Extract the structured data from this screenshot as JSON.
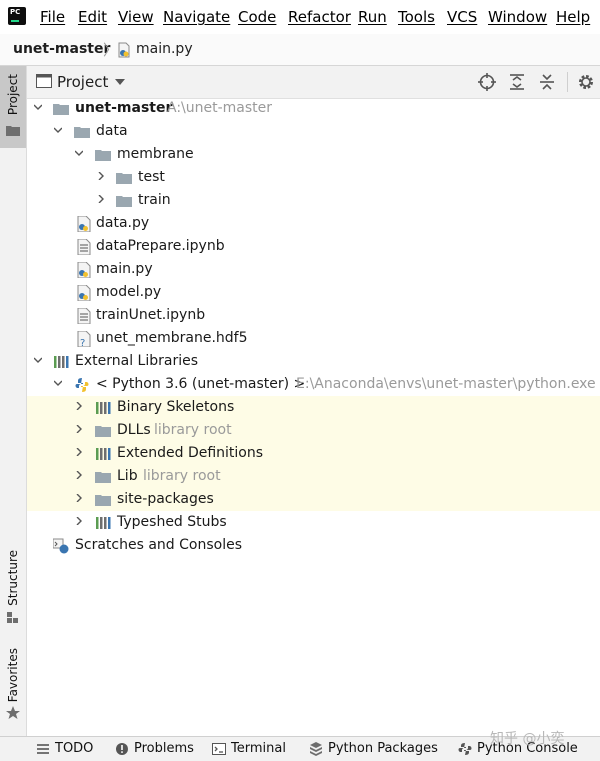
{
  "menu": [
    "File",
    "Edit",
    "View",
    "Navigate",
    "Code",
    "Refactor",
    "Run",
    "Tools",
    "VCS",
    "Window",
    "Help"
  ],
  "app_logo": "PC",
  "nav": {
    "project": "unet-master",
    "separator": "〉",
    "file": "main.py"
  },
  "side_tabs": {
    "project": "Project",
    "structure": "Structure",
    "favorites": "Favorites"
  },
  "project_panel": {
    "title": "Project",
    "toolbar_icons": [
      "locate-icon",
      "expand-all-icon",
      "collapse-all-icon",
      "gear-icon"
    ]
  },
  "tree": {
    "root": {
      "label": "unet-master",
      "path": "A:\\unet-master"
    },
    "data_folder": "data",
    "membrane_folder": "membrane",
    "test_folder": "test",
    "train_folder": "train",
    "files": [
      "data.py",
      "dataPrepare.ipynb",
      "main.py",
      "model.py",
      "trainUnet.ipynb",
      "unet_membrane.hdf5"
    ],
    "external_libraries": "External Libraries",
    "python_sdk": {
      "label": "< Python 3.6 (unet-master) >",
      "path": "E:\\Anaconda\\envs\\unet-master\\python.exe"
    },
    "sdk_items": [
      {
        "label": "Binary Skeletons",
        "hint": ""
      },
      {
        "label": "DLLs",
        "hint": "library root"
      },
      {
        "label": "Extended Definitions",
        "hint": ""
      },
      {
        "label": "Lib",
        "hint": "library root"
      },
      {
        "label": "site-packages",
        "hint": ""
      },
      {
        "label": "Typeshed Stubs",
        "hint": ""
      }
    ],
    "scratches": "Scratches and Consoles"
  },
  "status_bar": [
    "TODO",
    "Problems",
    "Terminal",
    "Python Packages",
    "Python Console"
  ],
  "watermark": "知乎 @小奕",
  "colors": {
    "folder": "#9aa7b0",
    "python_blue": "#3a75b0",
    "python_yellow": "#f2c12e",
    "highlight": "#fefce6",
    "project_tab": "#c8c8c8"
  }
}
